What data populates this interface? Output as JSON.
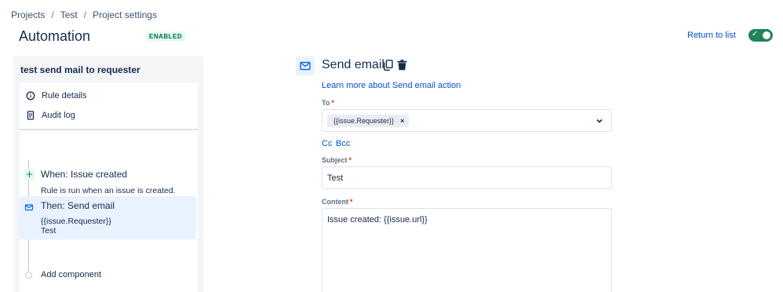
{
  "breadcrumb": {
    "items": [
      "Projects",
      "Test",
      "Project settings"
    ],
    "separator": "/"
  },
  "header": {
    "title": "Automation",
    "status": "ENABLED",
    "return_label": "Return to list",
    "toggle_on": true
  },
  "rule": {
    "name": "test send mail to requester",
    "menu": [
      {
        "label": "Rule details",
        "icon": "info-icon"
      },
      {
        "label": "Audit log",
        "icon": "document-icon"
      }
    ],
    "trigger": {
      "title": "When: Issue created",
      "description": "Rule is run when an issue is created.",
      "icon": "plus-icon"
    },
    "action": {
      "title": "Then: Send email",
      "line1": "{{issue.Requester}}",
      "line2": "Test",
      "icon": "mail-icon"
    },
    "add_component": "Add component"
  },
  "editor": {
    "title": "Send email",
    "learn_more": "Learn more about Send email action",
    "to": {
      "label": "To",
      "required_mark": "*",
      "tag": "{{issue.Requester}}",
      "tag_remove": "×"
    },
    "cc_label": "Cc",
    "bcc_label": "Bcc",
    "subject": {
      "label": "Subject",
      "required_mark": "*",
      "value": "Test"
    },
    "content": {
      "label": "Content",
      "required_mark": "*",
      "value": "Issue created: {{issue.url}}"
    }
  },
  "colors": {
    "accent": "#0052cc",
    "toggle": "#1f845a",
    "enabled_bg": "#e3fcef",
    "selected_bg": "#e9f2ff"
  }
}
